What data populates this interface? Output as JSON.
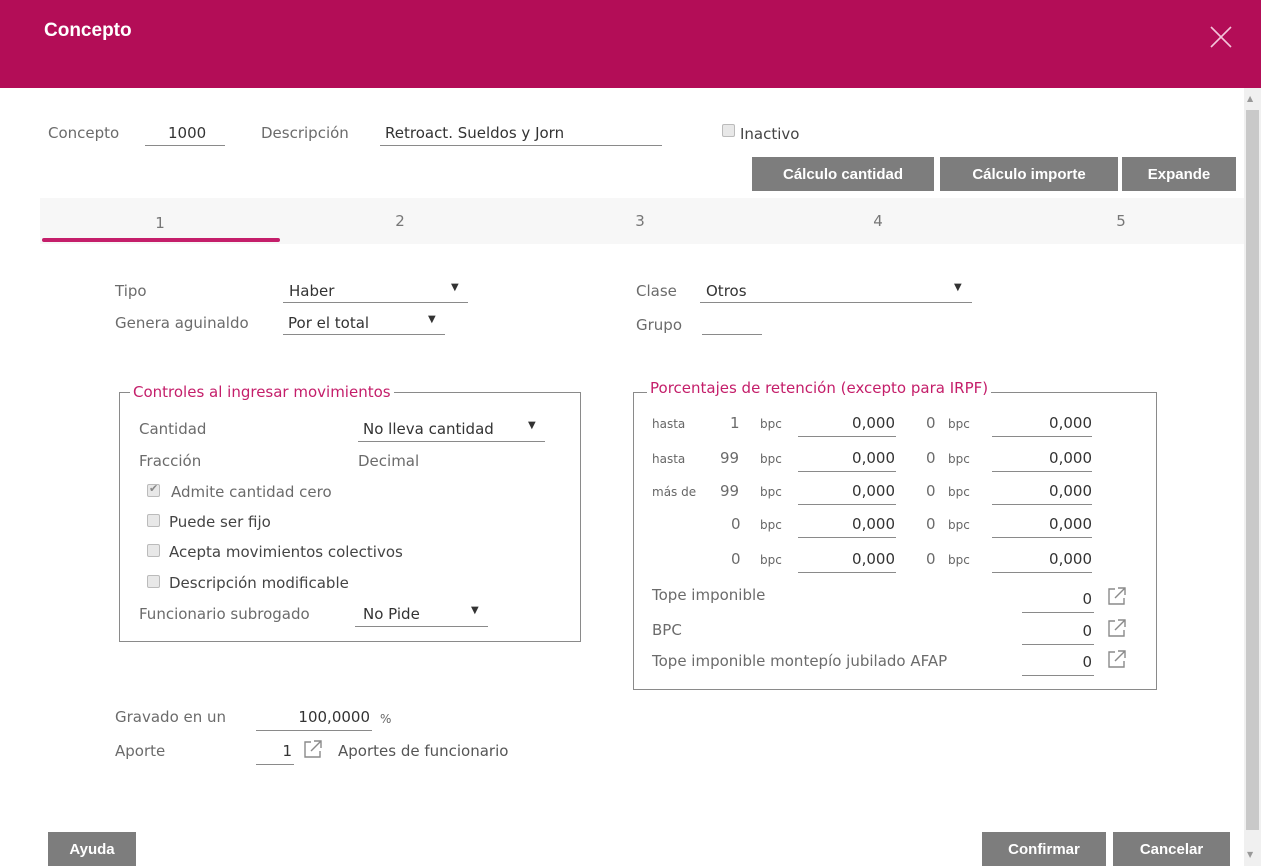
{
  "window": {
    "title": "Concepto"
  },
  "header": {
    "concepto_label": "Concepto",
    "concepto_value": "1000",
    "descripcion_label": "Descripción",
    "descripcion_value": "Retroact. Sueldos y Jorn",
    "inactivo_label": "Inactivo",
    "inactivo_checked": false
  },
  "toolbar": {
    "calculo_cantidad": "Cálculo cantidad",
    "calculo_importe": "Cálculo importe",
    "expande": "Expande"
  },
  "tabs": [
    {
      "label": "1",
      "active": true
    },
    {
      "label": "2",
      "active": false
    },
    {
      "label": "3",
      "active": false
    },
    {
      "label": "4",
      "active": false
    },
    {
      "label": "5",
      "active": false
    }
  ],
  "general": {
    "tipo_label": "Tipo",
    "tipo_value": "Haber",
    "clase_label": "Clase",
    "clase_value": "Otros",
    "aguinaldo_label": "Genera aguinaldo",
    "aguinaldo_value": "Por el total",
    "grupo_label": "Grupo",
    "grupo_value": ""
  },
  "controles": {
    "legend": "Controles al ingresar movimientos",
    "cantidad_label": "Cantidad",
    "cantidad_value": "No lleva cantidad",
    "fraccion_label": "Fracción",
    "fraccion_value": "Decimal",
    "checks": [
      {
        "label": "Admite cantidad cero",
        "checked": true
      },
      {
        "label": "Puede ser fijo",
        "checked": false
      },
      {
        "label": "Acepta movimientos colectivos",
        "checked": false
      },
      {
        "label": "Descripción modificable",
        "checked": false
      }
    ],
    "subrogado_label": "Funcionario subrogado",
    "subrogado_value": "No Pide"
  },
  "retencion": {
    "legend": "Porcentajes de retención (excepto para IRPF)",
    "rows": [
      {
        "prefix": "hasta",
        "n1": "1",
        "u1": "bpc",
        "v1": "0,000",
        "n2": "0",
        "u2": "bpc",
        "v2": "0,000"
      },
      {
        "prefix": "hasta",
        "n1": "99",
        "u1": "bpc",
        "v1": "0,000",
        "n2": "0",
        "u2": "bpc",
        "v2": "0,000"
      },
      {
        "prefix": "más de",
        "n1": "99",
        "u1": "bpc",
        "v1": "0,000",
        "n2": "0",
        "u2": "bpc",
        "v2": "0,000"
      },
      {
        "prefix": "",
        "n1": "0",
        "u1": "bpc",
        "v1": "0,000",
        "n2": "0",
        "u2": "bpc",
        "v2": "0,000"
      },
      {
        "prefix": "",
        "n1": "0",
        "u1": "bpc",
        "v1": "0,000",
        "n2": "0",
        "u2": "bpc",
        "v2": "0,000"
      }
    ],
    "tope_label": "Tope imponible",
    "tope_value": "0",
    "bpc_label": "BPC",
    "bpc_value": "0",
    "tope_afap_label": "Tope imponible montepío jubilado AFAP",
    "tope_afap_value": "0"
  },
  "footer_fields": {
    "gravado_label": "Gravado en un",
    "gravado_value": "100,0000",
    "gravado_unit": "%",
    "aporte_label": "Aporte",
    "aporte_value": "1",
    "aporte_desc": "Aportes de funcionario"
  },
  "buttons": {
    "ayuda": "Ayuda",
    "confirmar": "Confirmar",
    "cancelar": "Cancelar"
  },
  "icons": {
    "close": "close-icon",
    "external": "external-link-icon",
    "dropdown": "dropdown-arrow-icon"
  },
  "colors": {
    "brand": "#b30d57",
    "accent": "#c41e6a",
    "button": "#7d7d7d"
  }
}
